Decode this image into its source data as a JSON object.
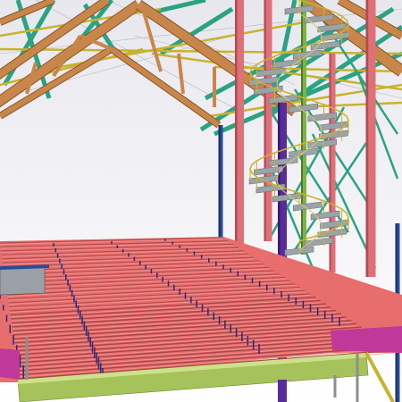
{
  "viewport": {
    "label": "",
    "colors": {
      "background_top": "#e7e7ee",
      "background_bottom": "#ffffff",
      "truss_orange": "#c9864a",
      "truss_orange_dark": "#8a5527",
      "brace_green": "#2aa383",
      "rail_yellow": "#c9b32e",
      "column_red": "#e07078",
      "column_red_dark": "#b04a55",
      "column_blue": "#2a4a9a",
      "column_purple": "#5a2aa0",
      "column_green": "#7cb342",
      "stair_grey": "#9aa3a8",
      "deck_red": "#e86e6e",
      "deck_red_dark": "#a84646",
      "beam_green": "#a6c25a",
      "beam_magenta": "#c0399a",
      "bolt_navy": "#2a2a7a"
    },
    "elements": [
      "roof-truss",
      "cross-brace",
      "steel-column",
      "spiral-stair",
      "floor-deck",
      "edge-beam"
    ]
  }
}
